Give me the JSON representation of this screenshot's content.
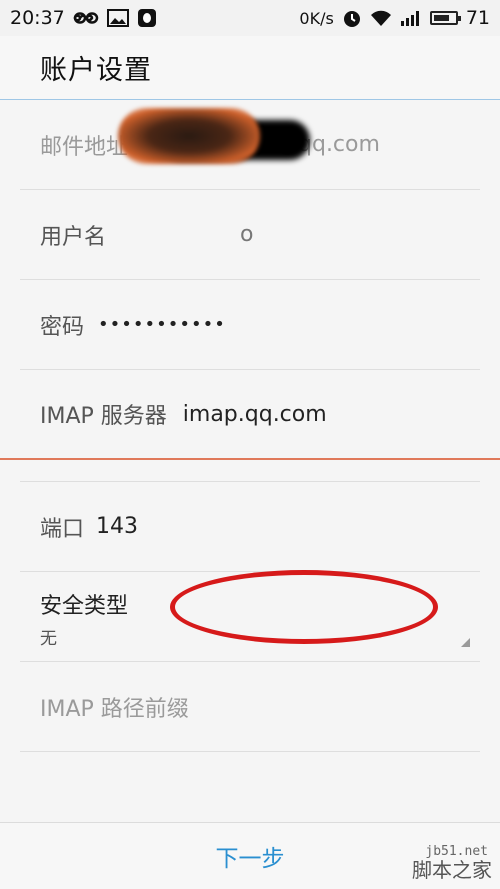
{
  "status_bar": {
    "time": "20:37",
    "net_speed": "0K/s",
    "battery_level": "71"
  },
  "app_bar": {
    "title": "账户设置"
  },
  "form": {
    "email": {
      "label": "邮件地址",
      "value_visible": "76@qq.com"
    },
    "username": {
      "label": "用户名",
      "value_visible": "o"
    },
    "password": {
      "label": "密码",
      "value": "•••••••••••"
    },
    "imap_server": {
      "label": "IMAP 服务器",
      "value": "imap.qq.com"
    },
    "port": {
      "label": "端口",
      "value": "143"
    },
    "security": {
      "label": "安全类型",
      "value": "无"
    },
    "imap_prefix": {
      "label": "IMAP 路径前缀"
    }
  },
  "footer": {
    "next_label": "下一步"
  },
  "watermark": {
    "site": "jb51.net",
    "text": "脚本之家"
  },
  "colors": {
    "accent_blue": "#2a8fd0",
    "active_underline": "#e0795a",
    "annotation_red": "#d61a1a"
  }
}
